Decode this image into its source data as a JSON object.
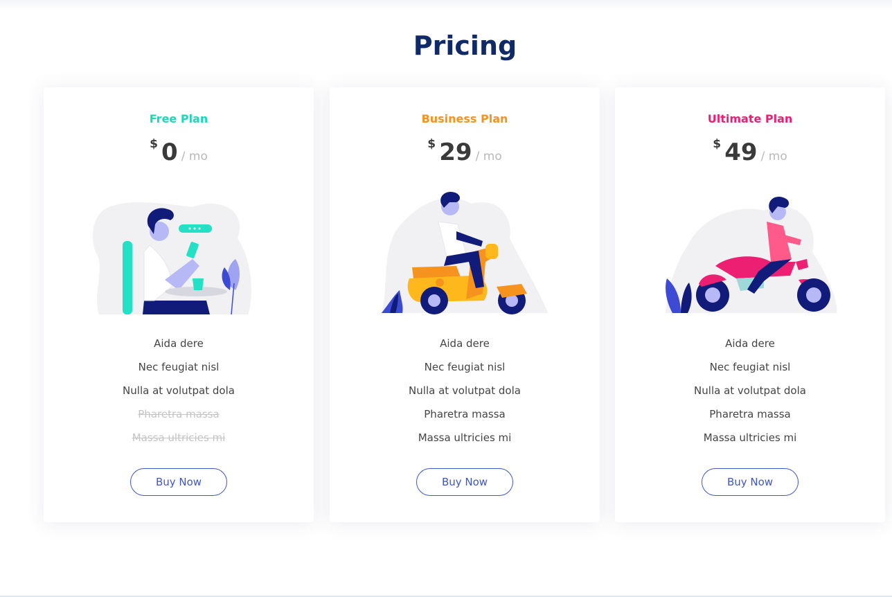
{
  "section": {
    "title": "Pricing"
  },
  "plans": [
    {
      "name": "Free Plan",
      "name_color": "#19d9b8",
      "currency": "$",
      "amount": "0",
      "period": "/ mo",
      "illustration": "person-with-phone-at-table",
      "features": [
        "Aida dere",
        "Nec feugiat nisl",
        "Nulla at volutpat dola",
        "Pharetra massa",
        "Massa ultricies mi"
      ],
      "features_available": [
        true,
        true,
        true,
        false,
        false
      ],
      "button_label": "Buy Now"
    },
    {
      "name": "Business Plan",
      "name_color": "#f6921e",
      "currency": "$",
      "amount": "29",
      "period": "/ mo",
      "illustration": "person-on-scooter",
      "features": [
        "Aida dere",
        "Nec feugiat nisl",
        "Nulla at volutpat dola",
        "Pharetra massa",
        "Massa ultricies mi"
      ],
      "features_available": [
        true,
        true,
        true,
        true,
        true
      ],
      "button_label": "Buy Now"
    },
    {
      "name": "Ultimate Plan",
      "name_color": "#ec1f72",
      "currency": "$",
      "amount": "49",
      "period": "/ mo",
      "illustration": "person-on-motorcycle",
      "features": [
        "Aida dere",
        "Nec feugiat nisl",
        "Nulla at volutpat dola",
        "Pharetra massa",
        "Massa ultricies mi"
      ],
      "features_available": [
        true,
        true,
        true,
        true,
        true
      ],
      "button_label": "Buy Now"
    }
  ],
  "colors": {
    "title": "#0f2a66",
    "button": "#3e56c8",
    "price": "#3a3a3a",
    "muted": "#b9b9b9"
  }
}
